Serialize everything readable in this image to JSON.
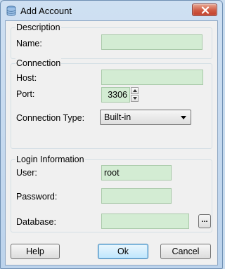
{
  "window": {
    "title": "Add Account"
  },
  "description": {
    "title": "Description",
    "name_label": "Name:",
    "name_value": ""
  },
  "connection": {
    "title": "Connection",
    "host_label": "Host:",
    "host_value": "",
    "port_label": "Port:",
    "port_value": "3306",
    "type_label": "Connection Type:",
    "type_value": "Built-in"
  },
  "login": {
    "title": "Login Information",
    "user_label": "User:",
    "user_value": "root",
    "password_label": "Password:",
    "password_value": "",
    "database_label": "Database:",
    "database_value": "",
    "browse_label": "..."
  },
  "buttons": {
    "help": "Help",
    "ok": "Ok",
    "cancel": "Cancel"
  },
  "colors": {
    "field_background": "#d3ecd3",
    "title_bar": "#c9dcef",
    "close_button": "#cf5a43"
  },
  "icons": {
    "app": "database-icon",
    "close": "close-icon",
    "spin_up": "chevron-up-icon",
    "spin_down": "chevron-down-icon",
    "combo": "dropdown-arrow-icon"
  }
}
